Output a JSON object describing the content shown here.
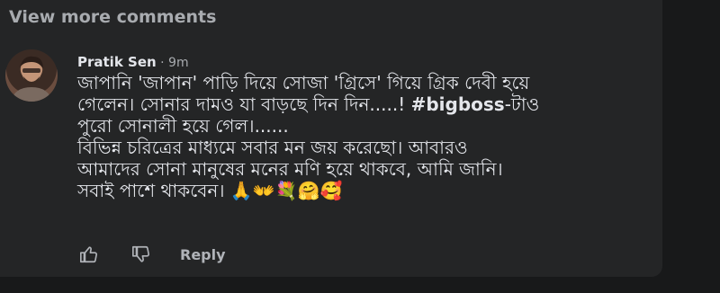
{
  "view_more": "View more comments",
  "comment": {
    "author": "Pratik Sen",
    "separator": " · ",
    "time": "9m",
    "text_before_tag": "জাপানি 'জাপান' পাড়ি দিয়ে সোজা 'গ্রিসে' গিয়ে গ্রিক দেবী হয়ে\nগেলেন। সোনার দামও যা বাড়ছে দিন দিন.....! ",
    "hashtag": "#bigboss",
    "text_after_tag": "-টাও\nপুরো সোনালী হয়ে গেল।......\nবিভিন্ন চরিত্রের মাধ্যমে সবার মন জয় করেছো। আবারও\nআমাদের সোনা মানুষের মনের মণি হয়ে থাকবে, আমি জানি।\nসবাই পাশে থাকবেন। ",
    "emojis": "🙏👐💐🤗🥰"
  },
  "actions": {
    "like_icon": "thumbs-up-icon",
    "dislike_icon": "thumbs-down-icon",
    "reply_label": "Reply"
  },
  "colors": {
    "background": "#18191a",
    "panel": "#242526",
    "text": "#e4e6eb",
    "secondary_text": "#a8abaf"
  }
}
